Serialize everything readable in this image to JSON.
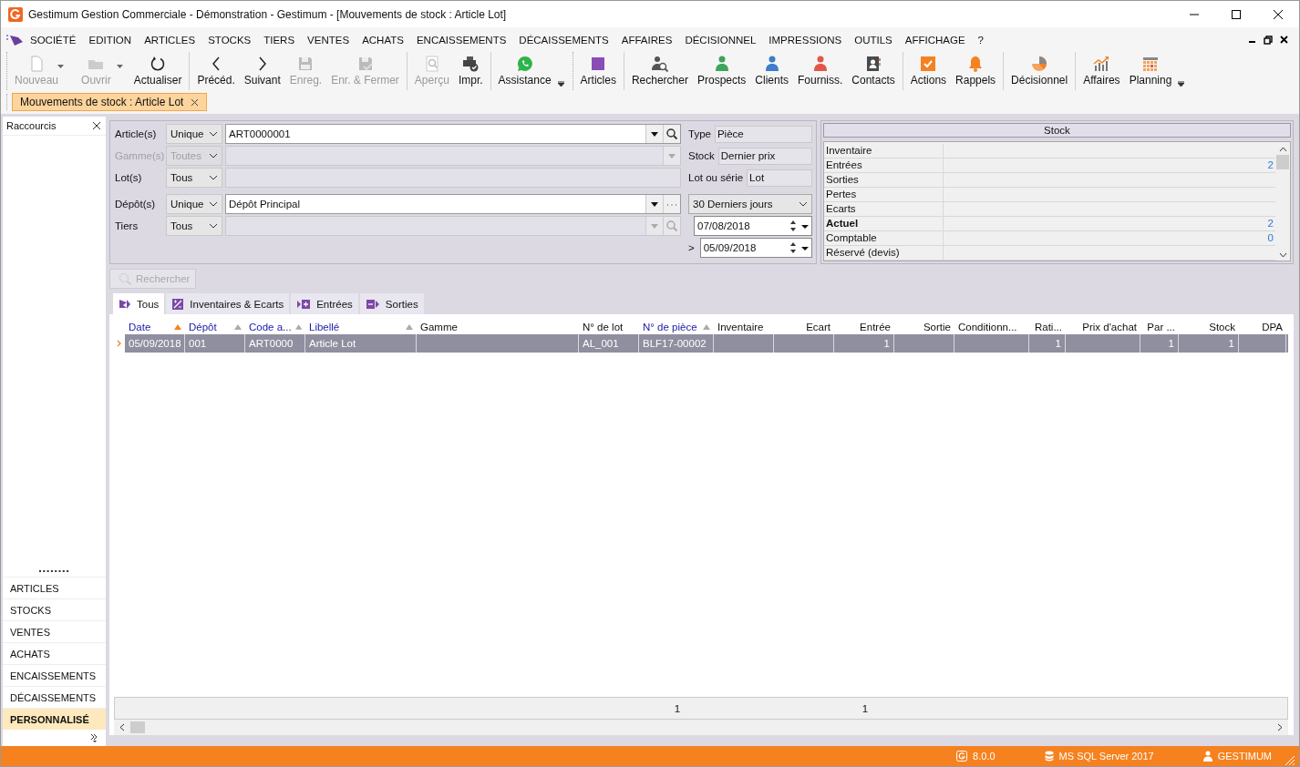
{
  "window": {
    "title": "Gestimum Gestion Commerciale - Démonstration - Gestimum - [Mouvements de stock : Article Lot]"
  },
  "menu": [
    {
      "label": "SOCIÉTÉ"
    },
    {
      "label": "EDITION"
    },
    {
      "label": "ARTICLES"
    },
    {
      "label": "STOCKS"
    },
    {
      "label": "TIERS"
    },
    {
      "label": "VENTES"
    },
    {
      "label": "ACHATS"
    },
    {
      "label": "ENCAISSEMENTS"
    },
    {
      "label": "DÉCAISSEMENTS"
    },
    {
      "label": "AFFAIRES"
    },
    {
      "label": "DÉCISIONNEL"
    },
    {
      "label": "IMPRESSIONS"
    },
    {
      "label": "OUTILS"
    },
    {
      "label": "AFFICHAGE"
    },
    {
      "label": "?"
    }
  ],
  "toolbar": [
    {
      "items": [
        {
          "label": "Nouveau",
          "kind": "page",
          "disabled": true,
          "dropdown": true
        },
        {
          "label": "Ouvrir",
          "kind": "folder",
          "disabled": true,
          "dropdown": true
        },
        {
          "label": "Actualiser",
          "kind": "refresh",
          "disabled": false,
          "dropdown": false
        }
      ]
    },
    {
      "items": [
        {
          "label": "Précéd.",
          "kind": "prev",
          "disabled": false,
          "dropdown": false
        },
        {
          "label": "Suivant",
          "kind": "next",
          "disabled": false,
          "dropdown": false
        },
        {
          "label": "Enreg.",
          "kind": "floppy",
          "disabled": true,
          "dropdown": false
        },
        {
          "label": "Enr. & Fermer",
          "kind": "floppycheck",
          "disabled": true,
          "dropdown": false
        }
      ]
    },
    {
      "items": [
        {
          "label": "Aperçu",
          "kind": "preview",
          "disabled": true,
          "dropdown": false
        },
        {
          "label": "Impr.",
          "kind": "printer",
          "disabled": false,
          "dropdown": false
        }
      ]
    },
    {
      "items": [
        {
          "label": "Assistance",
          "kind": "chat",
          "disabled": false,
          "dropdown": false
        }
      ]
    },
    {
      "items": [
        {
          "label": "Articles",
          "kind": "square",
          "disabled": false,
          "dropdown": false
        }
      ]
    },
    {
      "items": [
        {
          "label": "Rechercher",
          "kind": "personsearch",
          "disabled": false,
          "dropdown": false
        },
        {
          "label": "Prospects",
          "kind": "person",
          "color": "#3fa45b",
          "disabled": false,
          "dropdown": false
        },
        {
          "label": "Clients",
          "kind": "person",
          "color": "#3d7dc9",
          "disabled": false,
          "dropdown": false
        },
        {
          "label": "Fourniss.",
          "kind": "person",
          "color": "#e0574a",
          "disabled": false,
          "dropdown": false
        },
        {
          "label": "Contacts",
          "kind": "addressbook",
          "disabled": false,
          "dropdown": false
        }
      ]
    },
    {
      "items": [
        {
          "label": "Actions",
          "kind": "checkbox",
          "disabled": false,
          "dropdown": false
        },
        {
          "label": "Rappels",
          "kind": "bell",
          "disabled": false,
          "dropdown": false
        }
      ]
    },
    {
      "items": [
        {
          "label": "Décisionnel",
          "kind": "pie",
          "disabled": false,
          "dropdown": false
        }
      ]
    },
    {
      "items": [
        {
          "label": "Affaires",
          "kind": "barchart",
          "disabled": false,
          "dropdown": false
        },
        {
          "label": "Planning",
          "kind": "calendar",
          "disabled": false,
          "dropdown": false
        }
      ]
    }
  ],
  "doc_tabs": [
    {
      "label": "Mouvements de stock : Article Lot",
      "selected": true
    }
  ],
  "sidebar": {
    "title": "Raccourcis",
    "items": [
      {
        "label": "ARTICLES",
        "selected": false
      },
      {
        "label": "STOCKS",
        "selected": false
      },
      {
        "label": "VENTES",
        "selected": false
      },
      {
        "label": "ACHATS",
        "selected": false
      },
      {
        "label": "ENCAISSEMENTS",
        "selected": false
      },
      {
        "label": "DÉCAISSEMENTS",
        "selected": false
      },
      {
        "label": "PERSONNALISÉ",
        "selected": true
      }
    ]
  },
  "filters": [
    {
      "label": "Article(s)",
      "mode": "Unique",
      "value": "ART0000001",
      "disabled": false,
      "editable": true,
      "kind": "search"
    },
    {
      "label": "Gamme(s)",
      "mode": "Toutes",
      "disabled": true,
      "editable": false,
      "kind": "dropdown"
    },
    {
      "label": "Lot(s)",
      "mode": "Tous",
      "disabled": false,
      "editable": false,
      "kind": "plain"
    },
    {
      "label": "Dépôt(s)",
      "mode": "Unique",
      "value": "Dépôt Principal",
      "disabled": false,
      "editable": true,
      "kind": "more"
    },
    {
      "label": "Tiers",
      "mode": "Tous",
      "disabled": false,
      "editable": false,
      "kind": "search"
    }
  ],
  "info": [
    {
      "label": "Type",
      "value": "Pièce"
    },
    {
      "label": "Stock",
      "value": "Dernier prix"
    },
    {
      "label": "Lot ou série",
      "value": "Lot"
    }
  ],
  "period": {
    "preset": "30 Derniers jours",
    "from": "07/08/2018",
    "to_prefix": ">",
    "to": "05/09/2018"
  },
  "search_button": {
    "label": "Rechercher",
    "disabled": true
  },
  "stock": {
    "title": "Stock",
    "rows": [
      {
        "label": "Inventaire",
        "bold": false
      },
      {
        "label": "Entrées",
        "value": "2",
        "bold": false
      },
      {
        "label": "Sorties",
        "bold": false
      },
      {
        "label": "Pertes",
        "bold": false
      },
      {
        "label": "Ecarts",
        "bold": false
      },
      {
        "label": "Actuel",
        "value": "2",
        "bold": true
      },
      {
        "label": "Comptable",
        "value": "0",
        "bold": false
      },
      {
        "label": "Réservé (devis)",
        "bold": false
      }
    ]
  },
  "grid_tabs": [
    {
      "label": "Tous",
      "kind": "all",
      "selected": true
    },
    {
      "label": "Inventaires & Ecarts",
      "kind": "adjust",
      "selected": false
    },
    {
      "label": "Entrées",
      "kind": "in",
      "selected": false
    },
    {
      "label": "Sorties",
      "kind": "out",
      "selected": false
    }
  ],
  "table": {
    "columns": [
      {
        "label": "Date",
        "sortable": true,
        "sorted": true
      },
      {
        "label": "Dépôt",
        "sortable": true,
        "sorted": false
      },
      {
        "label": "Code a...",
        "sortable": true,
        "sorted": false
      },
      {
        "label": "Libellé",
        "sortable": true,
        "sorted": false
      },
      {
        "label": "Gamme",
        "sortable": false
      },
      {
        "label": "N° de lot",
        "sortable": false
      },
      {
        "label": "N° de pièce",
        "sortable": true,
        "sorted": false
      },
      {
        "label": "Inventaire",
        "sortable": false
      },
      {
        "label": "Ecart",
        "sortable": false
      },
      {
        "label": "Entrée",
        "sortable": false
      },
      {
        "label": "Sortie",
        "sortable": false
      },
      {
        "label": "Conditionn...",
        "sortable": false
      },
      {
        "label": "Rati...",
        "sortable": false
      },
      {
        "label": "Prix d'achat",
        "sortable": false
      },
      {
        "label": "Par ...",
        "sortable": false
      },
      {
        "label": "Stock",
        "sortable": false
      },
      {
        "label": "DPA",
        "sortable": false
      }
    ],
    "rows": [
      {
        "selected": true,
        "date": "05/09/2018",
        "depot": "001",
        "code": "ART0000",
        "libelle": "Article Lot",
        "lot": "AL_001",
        "piece": "BLF17-00002",
        "entree": "1",
        "ratio": "1",
        "par": "1",
        "stock": "1"
      }
    ],
    "footer": {
      "piece": "1",
      "entree": "1"
    }
  },
  "status_bar": [
    {
      "kind": "logo",
      "text": "8.0.0"
    },
    {
      "kind": "database",
      "text": "MS SQL Server 2017"
    },
    {
      "kind": "user",
      "text": "GESTIMUM"
    }
  ]
}
